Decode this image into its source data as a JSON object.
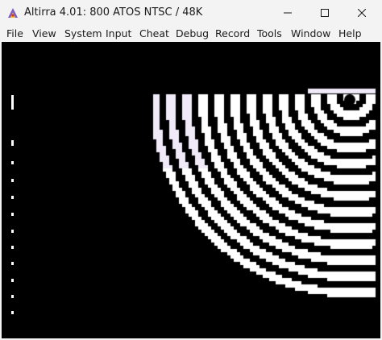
{
  "window": {
    "title": "Altirra 4.01: 800 ATOS NTSC / 48K",
    "icons": {
      "app": "altirra-app-icon",
      "minimize": "minimize-icon",
      "maximize": "maximize-icon",
      "close": "close-icon"
    }
  },
  "menu": {
    "items": [
      {
        "label": "File"
      },
      {
        "label": "View"
      },
      {
        "label": "System"
      },
      {
        "label": "Input"
      },
      {
        "label": "Cheat"
      },
      {
        "label": "Debug"
      },
      {
        "label": "Record"
      },
      {
        "label": "Tools"
      },
      {
        "label": "Window"
      },
      {
        "label": "Help"
      }
    ]
  },
  "display": {
    "background": "#000000",
    "foreground": "#ffffff",
    "highlight": "#efe9f8",
    "content": "concentric-ring-pattern"
  }
}
